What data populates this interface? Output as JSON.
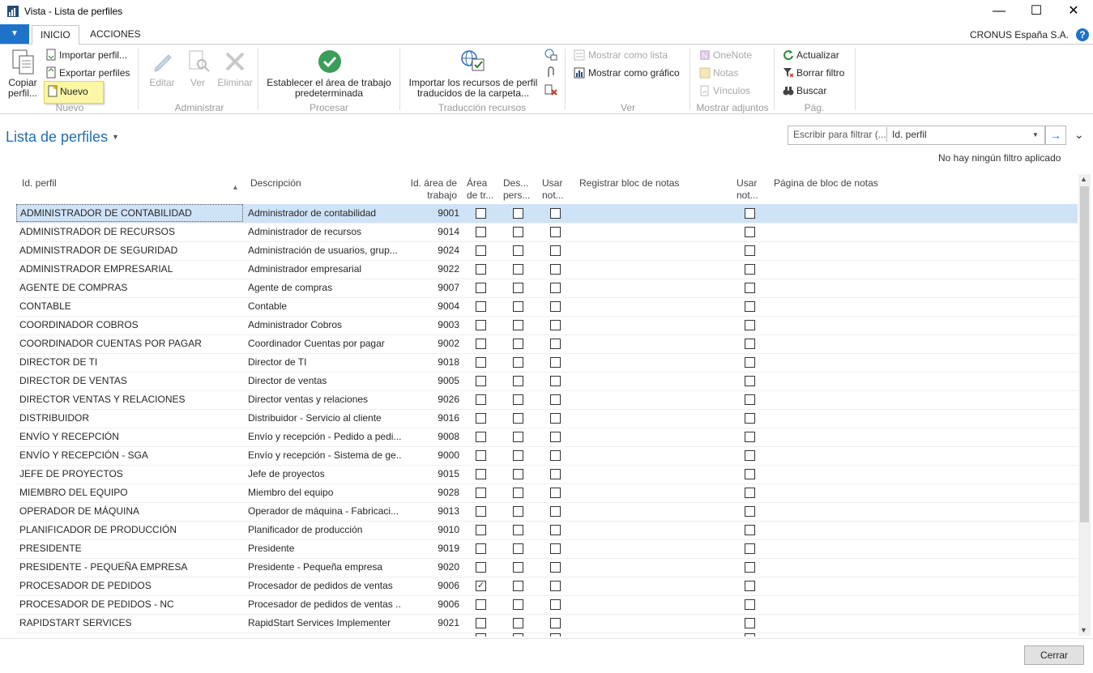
{
  "window": {
    "title": "Vista - Lista de perfiles",
    "minimize": "—",
    "maximize": "☐",
    "close": "✕"
  },
  "ribbon": {
    "tabs": [
      "INICIO",
      "ACCIONES"
    ],
    "company": "CRONUS España S.A.",
    "help": "?",
    "nuevo_group": {
      "copy": "Copiar perfil...",
      "import": "Importar perfil...",
      "export": "Exportar perfiles",
      "new": "Nuevo",
      "label": "Nuevo"
    },
    "administrar": {
      "edit": "Editar",
      "view": "Ver",
      "delete": "Eliminar",
      "label": "Administrar"
    },
    "procesar": {
      "set_default": "Establecer el área de trabajo predeterminada",
      "label": "Procesar"
    },
    "traduccion": {
      "import": "Importar los recursos de perfil traducidos de la carpeta...",
      "label": "Traducción recursos"
    },
    "ver": {
      "list": "Mostrar como lista",
      "chart": "Mostrar como gráfico",
      "label": "Ver"
    },
    "adjuntos": {
      "onenote": "OneNote",
      "notes": "Notas",
      "links": "Vínculos",
      "label": "Mostrar adjuntos"
    },
    "pag": {
      "refresh": "Actualizar",
      "clear": "Borrar filtro",
      "find": "Buscar",
      "label": "Pág."
    }
  },
  "page": {
    "title": "Lista de perfiles",
    "filter_placeholder": "Escribir para filtrar (...",
    "filter_field": "Id. perfil",
    "no_filter": "No hay ningún filtro aplicado",
    "close_button": "Cerrar"
  },
  "columns": {
    "id": "Id. perfil",
    "desc": "Descripción",
    "area1": "Id. área de",
    "area2": "trabajo",
    "c1a": "Área",
    "c1b": "de tr...",
    "c2a": "Des...",
    "c2b": "pers...",
    "c3a": "Usar",
    "c3b": "not...",
    "reg": "Registrar bloc de notas",
    "c4a": "Usar",
    "c4b": "not...",
    "page": "Página de bloc de notas"
  },
  "rows": [
    {
      "id": "ADMINISTRADOR DE CONTABILIDAD",
      "desc": "Administrador de contabilidad",
      "area": "9001",
      "c1": "",
      "selected": true
    },
    {
      "id": "ADMINISTRADOR DE RECURSOS",
      "desc": "Administrador de recursos",
      "area": "9014",
      "c1": ""
    },
    {
      "id": "ADMINISTRADOR DE SEGURIDAD",
      "desc": "Administración de usuarios, grup...",
      "area": "9024",
      "c1": ""
    },
    {
      "id": "ADMINISTRADOR EMPRESARIAL",
      "desc": "Administrador empresarial",
      "area": "9022",
      "c1": ""
    },
    {
      "id": "AGENTE DE COMPRAS",
      "desc": "Agente de compras",
      "area": "9007",
      "c1": ""
    },
    {
      "id": "CONTABLE",
      "desc": "Contable",
      "area": "9004",
      "c1": ""
    },
    {
      "id": "COORDINADOR COBROS",
      "desc": "Administrador Cobros",
      "area": "9003",
      "c1": ""
    },
    {
      "id": "COORDINADOR CUENTAS POR PAGAR",
      "desc": "Coordinador Cuentas por pagar",
      "area": "9002",
      "c1": ""
    },
    {
      "id": "DIRECTOR DE TI",
      "desc": "Director de TI",
      "area": "9018",
      "c1": ""
    },
    {
      "id": "DIRECTOR DE VENTAS",
      "desc": "Director de ventas",
      "area": "9005",
      "c1": ""
    },
    {
      "id": "DIRECTOR VENTAS Y RELACIONES",
      "desc": "Director ventas y relaciones",
      "area": "9026",
      "c1": ""
    },
    {
      "id": "DISTRIBUIDOR",
      "desc": "Distribuidor - Servicio al cliente",
      "area": "9016",
      "c1": ""
    },
    {
      "id": "ENVÍO Y RECEPCIÓN",
      "desc": "Envío y recepción - Pedido a pedi...",
      "area": "9008",
      "c1": ""
    },
    {
      "id": "ENVÍO Y RECEPCIÓN - SGA",
      "desc": "Envío y recepción - Sistema de ge...",
      "area": "9000",
      "c1": ""
    },
    {
      "id": "JEFE DE PROYECTOS",
      "desc": "Jefe de proyectos",
      "area": "9015",
      "c1": ""
    },
    {
      "id": "MIEMBRO DEL EQUIPO",
      "desc": "Miembro del equipo",
      "area": "9028",
      "c1": ""
    },
    {
      "id": "OPERADOR DE MÁQUINA",
      "desc": "Operador de máquina - Fabricaci...",
      "area": "9013",
      "c1": ""
    },
    {
      "id": "PLANIFICADOR DE PRODUCCIÓN",
      "desc": "Planificador de producción",
      "area": "9010",
      "c1": ""
    },
    {
      "id": "PRESIDENTE",
      "desc": "Presidente",
      "area": "9019",
      "c1": ""
    },
    {
      "id": "PRESIDENTE - PEQUEÑA EMPRESA",
      "desc": "Presidente - Pequeña empresa",
      "area": "9020",
      "c1": ""
    },
    {
      "id": "PROCESADOR DE PEDIDOS",
      "desc": "Procesador de pedidos de ventas",
      "area": "9006",
      "c1": "✓"
    },
    {
      "id": "PROCESADOR DE PEDIDOS - NC",
      "desc": "Procesador de pedidos de ventas ...",
      "area": "9006",
      "c1": ""
    },
    {
      "id": "RAPIDSTART SERVICES",
      "desc": "RapidStart Services Implementer",
      "area": "9021",
      "c1": ""
    }
  ]
}
